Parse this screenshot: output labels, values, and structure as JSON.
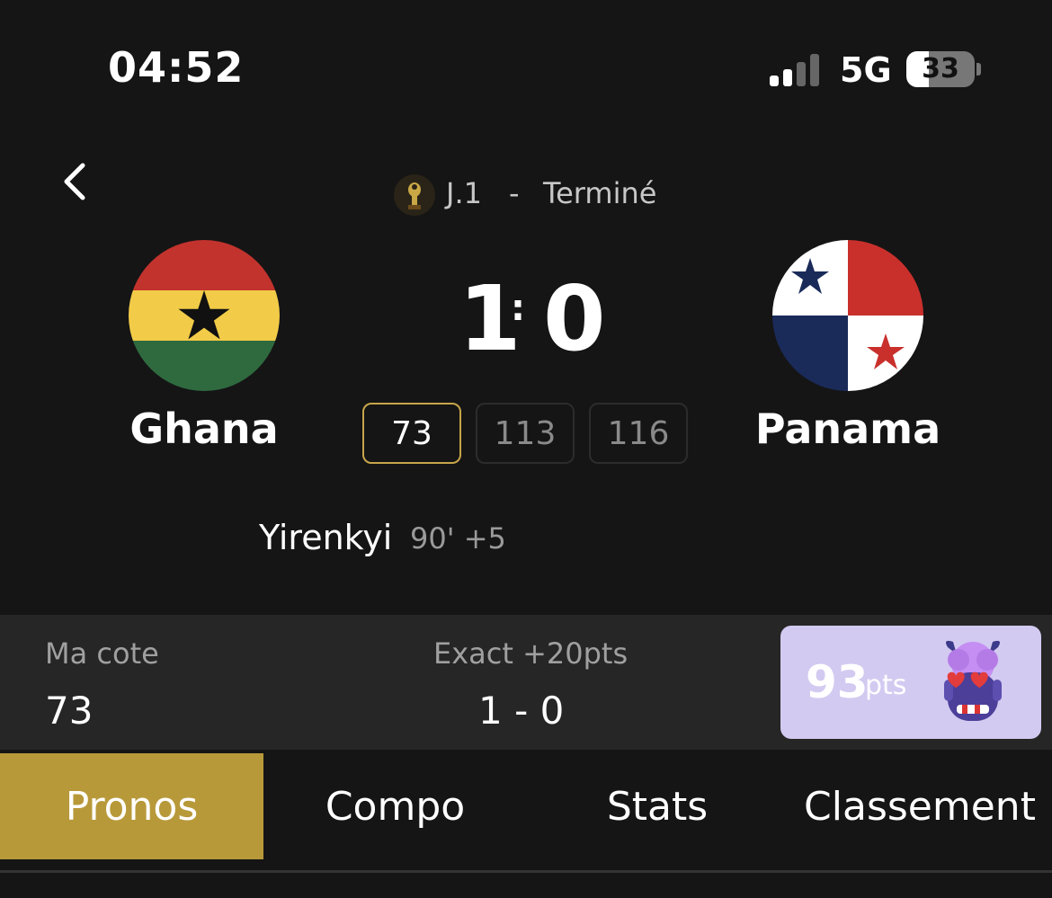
{
  "status_bar": {
    "time": "04:52",
    "network": "5G",
    "battery": "33",
    "battery_level": 0.33,
    "signal_bars_active": 2
  },
  "header": {
    "matchday": "J.1",
    "separator": "-",
    "status": "Terminé",
    "competition_icon": "trophy-icon"
  },
  "match": {
    "home": {
      "name": "Ghana",
      "score": "1"
    },
    "away": {
      "name": "Panama",
      "score": "0"
    },
    "score_separator": ":",
    "odds": [
      {
        "value": "73",
        "selected": true
      },
      {
        "value": "113",
        "selected": false
      },
      {
        "value": "116",
        "selected": false
      }
    ],
    "goal": {
      "scorer": "Yirenkyi",
      "minute": "90' +5"
    }
  },
  "info": {
    "my_odds_label": "Ma cote",
    "my_odds_value": "73",
    "exact_label": "Exact +20pts",
    "exact_value": "1 - 0",
    "points_value": "93",
    "points_unit": "pts"
  },
  "tabs": [
    {
      "label": "Pronos",
      "active": true
    },
    {
      "label": "Compo",
      "active": false
    },
    {
      "label": "Stats",
      "active": false
    },
    {
      "label": "Classement",
      "active": false
    }
  ],
  "colors": {
    "background": "#151515",
    "accent_gold": "#b8993a",
    "selected_border": "#c7a54a",
    "points_card": "#d3caf1"
  }
}
